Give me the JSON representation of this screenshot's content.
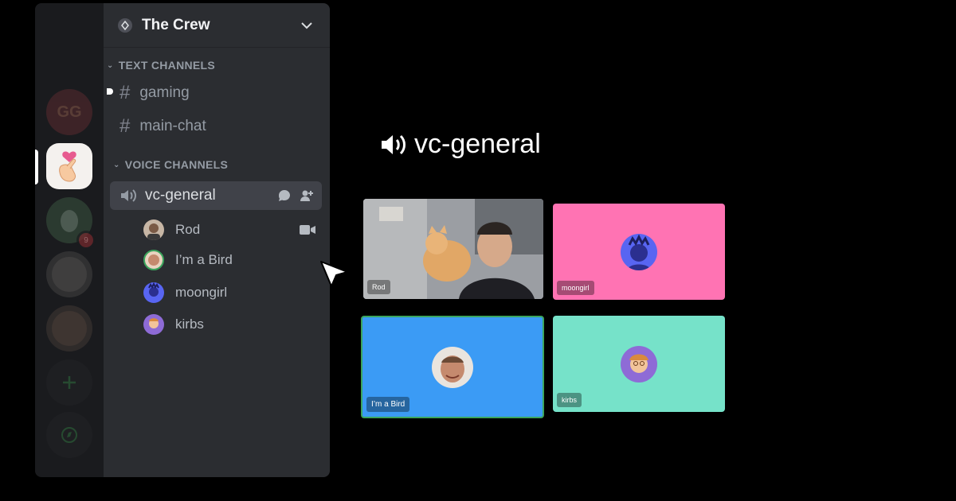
{
  "server": {
    "name": "The Crew",
    "rail_initials": "GG"
  },
  "categories": {
    "text": "TEXT CHANNELS",
    "voice": "VOICE CHANNELS"
  },
  "text_channels": [
    {
      "name": "gaming",
      "unread": true
    },
    {
      "name": "main-chat",
      "unread": false
    }
  ],
  "voice_channel": {
    "name": "vc-general",
    "members": [
      {
        "name": "Rod",
        "video": true
      },
      {
        "name": "I’m a Bird",
        "video": false
      },
      {
        "name": "moongirl",
        "video": false
      },
      {
        "name": "kirbs",
        "video": false
      }
    ]
  },
  "call": {
    "title": "vc-general",
    "tiles": [
      {
        "name": "Rod",
        "kind": "video",
        "color": "#8a8f96"
      },
      {
        "name": "moongirl",
        "kind": "avatar",
        "color": "#ff73b3"
      },
      {
        "name": "I’m a Bird",
        "kind": "avatar",
        "color": "#3b9bf5",
        "speaking": true
      },
      {
        "name": "kirbs",
        "kind": "avatar",
        "color": "#76e2c9"
      }
    ]
  },
  "colors": {
    "speaking_outline": "#3ba55d",
    "sidebar_bg": "#2b2d31",
    "rail_bg": "#1a1b1e",
    "active_channel_bg": "#404249"
  }
}
